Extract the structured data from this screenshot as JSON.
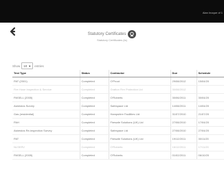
{
  "header": {
    "user_text": "Alan Inoque of 1"
  },
  "page": {
    "title": "Statutory Certificates",
    "subtitle": "Statutory Certificates (ts)",
    "back_icon": "arrow-left-icon",
    "badge_icon": "certificate-icon"
  },
  "table_controls": {
    "show_label": "Show",
    "page_length": "10",
    "entries_label": "entries"
  },
  "table": {
    "columns": [
      "Test Type",
      "Status",
      "Contractor",
      "Due",
      "Schedule"
    ],
    "rows": [
      {
        "test_type": "PAT (2001)",
        "status": "Completed",
        "contractor": "O'Proot",
        "due": "29/08/2012",
        "schedule": "15/04/20"
      },
      {
        "test_type": "Fire Hose Inspection & Service",
        "status": "Completed",
        "contractor": "Gratton Fire Protection Ltd",
        "due": "30/08/2012",
        "schedule": ""
      },
      {
        "test_type": "PASELL (2005)",
        "status": "Completed",
        "contractor": "O'Roberts",
        "due": "30/06/2011",
        "schedule": "30/04/20"
      },
      {
        "test_type": "Asbestos Survey",
        "status": "Completed",
        "contractor": "Safespace Ltd",
        "due": "14/08/2011",
        "schedule": "14/04/20"
      },
      {
        "test_type": "Gas (residential)",
        "status": "Completed",
        "contractor": "Hampshire Facilities Ltd",
        "due": "31/07/2010",
        "schedule": "21/07/20"
      },
      {
        "test_type": "PAH",
        "status": "Completed",
        "contractor": "Firesafe Solutions (UK) Ltd",
        "due": "27/08/2010",
        "schedule": "17/04/20"
      },
      {
        "test_type": "Asbestos Re-inspection Survey",
        "status": "Completed",
        "contractor": "Safespace Ltd",
        "due": "27/08/2010",
        "schedule": "27/04/20"
      },
      {
        "test_type": "PAT",
        "status": "Completed",
        "contractor": "Firesafe Solutions (UK) Ltd",
        "due": "19/12/2011",
        "schedule": "30/11/20"
      },
      {
        "test_type": "NLSERV",
        "status": "Completed",
        "contractor": "O'Roberts",
        "due": "16/12/2011",
        "schedule": "17/11/20"
      },
      {
        "test_type": "PASELL (2005)",
        "status": "Completed",
        "contractor": "O'Roberts",
        "due": "01/02/2011",
        "schedule": "06/10/20"
      }
    ]
  }
}
